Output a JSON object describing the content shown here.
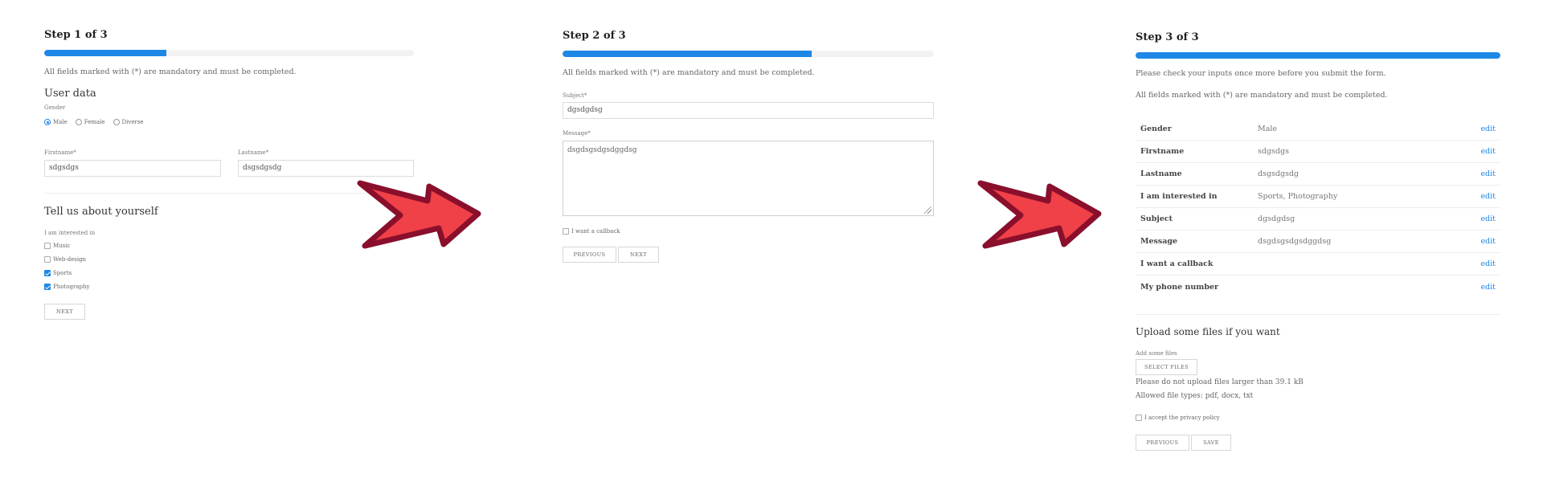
{
  "colors": {
    "accent": "#1f87e5",
    "arrow_fill": "#f04048",
    "arrow_stroke": "#8a0f2c"
  },
  "step1": {
    "title": "Step 1 of 3",
    "progress": 0.33,
    "mandatory_note": "All fields marked with (*) are mandatory and must be completed.",
    "section_user_data": "User data",
    "gender_label": "Gender",
    "gender_options": [
      {
        "label": "Male",
        "selected": true
      },
      {
        "label": "Female",
        "selected": false
      },
      {
        "label": "Diverse",
        "selected": false
      }
    ],
    "firstname_label": "Firstname*",
    "firstname_value": "sdgsdgs",
    "lastname_label": "Lastname*",
    "lastname_value": "dsgsdgsdg",
    "section_about": "Tell us about yourself",
    "interests_label": "I am interested in",
    "interests": [
      {
        "label": "Music",
        "checked": false
      },
      {
        "label": "Web-design",
        "checked": false
      },
      {
        "label": "Sports",
        "checked": true
      },
      {
        "label": "Photography",
        "checked": true
      }
    ],
    "next_label": "NEXT"
  },
  "step2": {
    "title": "Step 2 of 3",
    "progress": 0.67,
    "mandatory_note": "All fields marked with (*) are mandatory and must be completed.",
    "subject_label": "Subject*",
    "subject_value": "dgsdgdsg",
    "message_label": "Message*",
    "message_value": "dsgdsgsdgsdggdsg",
    "callback_label": "I want a callback",
    "callback_checked": false,
    "previous_label": "PREVIOUS",
    "next_label": "NEXT"
  },
  "step3": {
    "title": "Step 3 of 3",
    "progress": 1.0,
    "check_note": "Please check your inputs once more before you submit the form.",
    "mandatory_note": "All fields marked with (*) are mandatory and must be completed.",
    "review": [
      {
        "label": "Gender",
        "value": "Male",
        "edit": "edit"
      },
      {
        "label": "Firstname",
        "value": "sdgsdgs",
        "edit": "edit"
      },
      {
        "label": "Lastname",
        "value": "dsgsdgsdg",
        "edit": "edit"
      },
      {
        "label": "I am interested in",
        "value": "Sports, Photography",
        "edit": "edit"
      },
      {
        "label": "Subject",
        "value": "dgsdgdsg",
        "edit": "edit"
      },
      {
        "label": "Message",
        "value": "dsgdsgsdgsdggdsg",
        "edit": "edit"
      },
      {
        "label": "I want a callback",
        "value": "",
        "edit": "edit"
      },
      {
        "label": "My phone number",
        "value": "",
        "edit": "edit"
      }
    ],
    "upload_heading": "Upload some files if you want",
    "add_files_label": "Add some files",
    "select_files_label": "SELECT FILES",
    "file_size_note": "Please do not upload files larger than 39.1 kB",
    "file_types_note": "Allowed file types: pdf, docx, txt",
    "privacy_label": "I accept the privacy policy",
    "privacy_checked": false,
    "previous_label": "PREVIOUS",
    "save_label": "SAVE"
  },
  "arrows": [
    {
      "icon": "arrow-right-icon"
    },
    {
      "icon": "arrow-right-icon"
    }
  ]
}
